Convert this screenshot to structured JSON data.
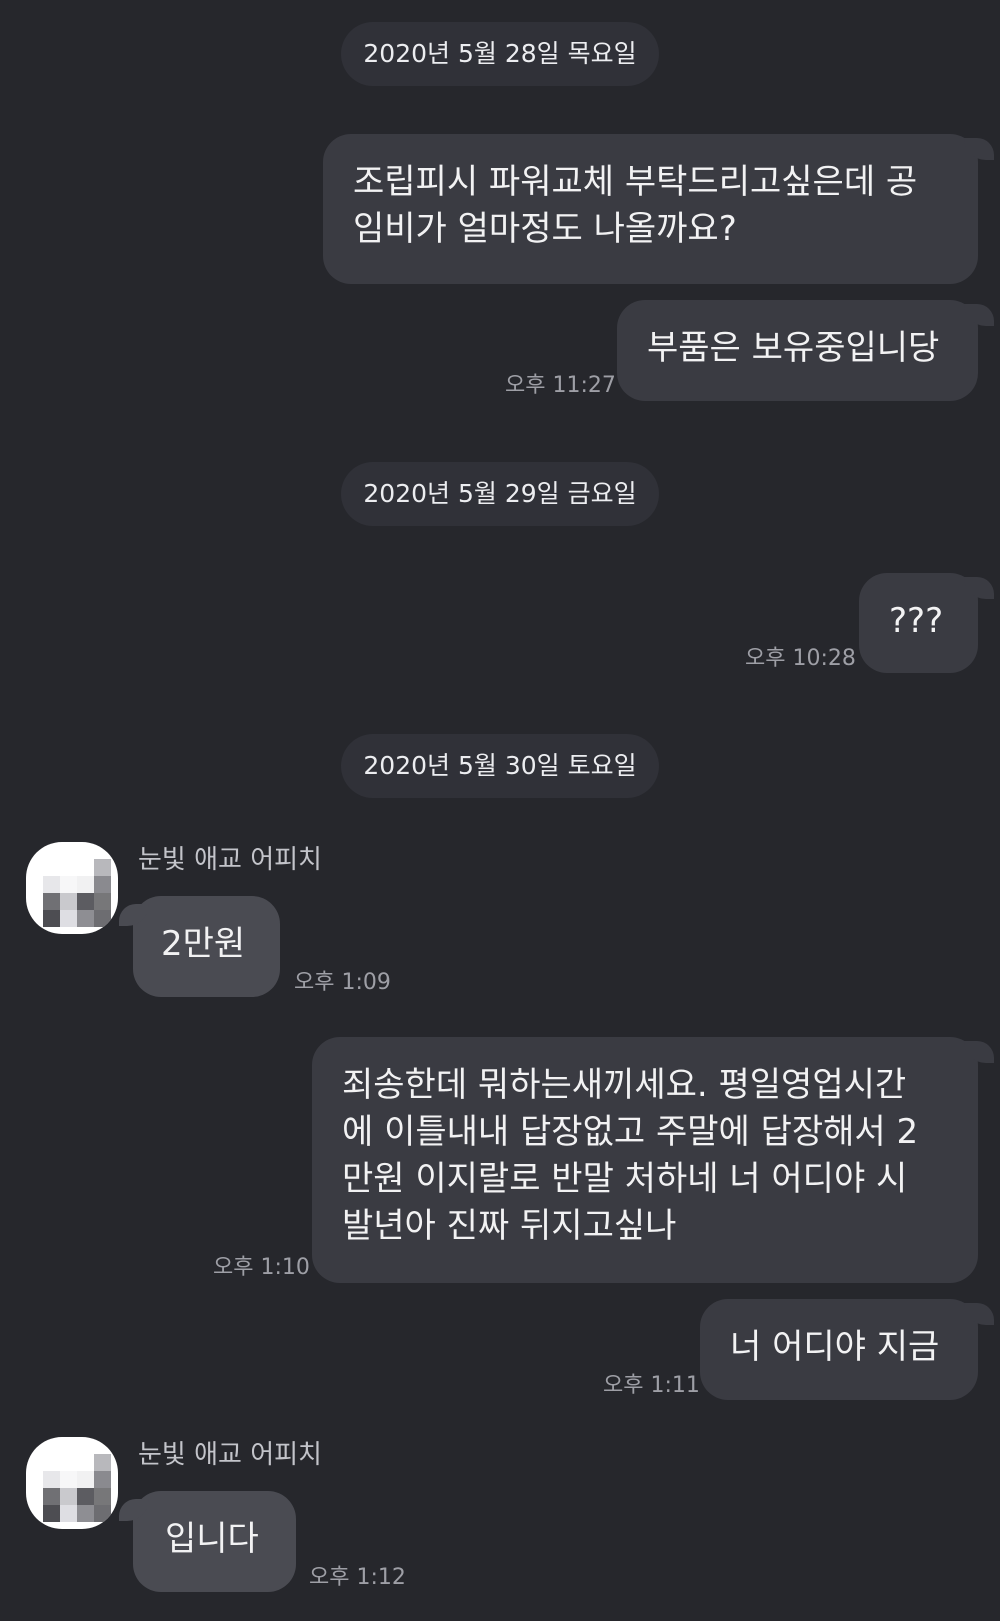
{
  "dates": [
    "2020년 5월 28일 목요일",
    "2020년 5월 29일 금요일",
    "2020년 5월 30일 토요일"
  ],
  "messages": [
    {
      "text": "조립피시 파워교체 부탁드리고싶은데 공\n임비가 얼마정도 나올까요?",
      "time": ""
    },
    {
      "text": "부품은 보유중입니당",
      "time": "오후 11:27"
    },
    {
      "text": "???",
      "time": "오후 10:28"
    },
    {
      "sender": "눈빛 애교 어피치",
      "text": "2만원",
      "time": "오후 1:09"
    },
    {
      "text": "죄송한데 뭐하는새끼세요. 평일영업시간\n에 이틀내내 답장없고 주말에 답장해서 2\n만원 이지랄로 반말 처하네 너 어디야 시\n발년아 진짜 뒤지고싶나",
      "time": "오후 1:10"
    },
    {
      "text": "너 어디야 지금",
      "time": "오후 1:11"
    },
    {
      "sender": "눈빛 애교 어피치",
      "text": "입니다",
      "time": "오후 1:12"
    }
  ],
  "colors": {
    "background": "#26272c",
    "outgoing_bubble": "#3a3b42",
    "incoming_bubble": "#4a4b52",
    "date_pill": "#303138",
    "timestamp": "#9e9fa6"
  }
}
